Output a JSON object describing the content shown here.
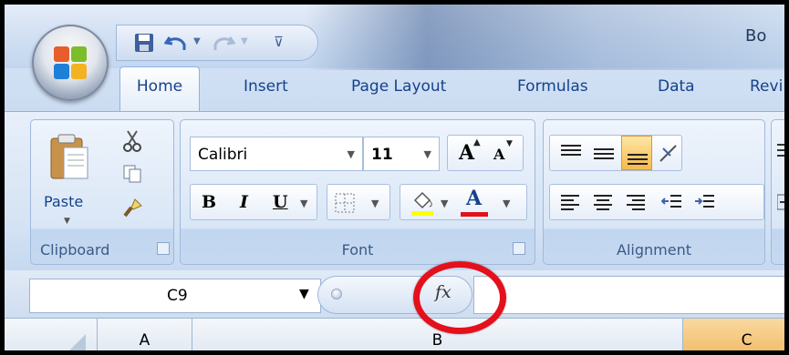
{
  "app": {
    "title_partial": "Bo"
  },
  "tabs": [
    {
      "label": "Home",
      "active": true
    },
    {
      "label": "Insert"
    },
    {
      "label": "Page Layout"
    },
    {
      "label": "Formulas"
    },
    {
      "label": "Data"
    },
    {
      "label": "Revi"
    }
  ],
  "ribbon": {
    "clipboard": {
      "label": "Clipboard",
      "paste_label": "Paste"
    },
    "font": {
      "label": "Font",
      "font_name": "Calibri",
      "font_size": "11",
      "grow_label": "A",
      "shrink_label": "A",
      "bold_label": "B",
      "italic_label": "I",
      "underline_label": "U",
      "font_color_label": "A",
      "highlight_color": "#ffff00",
      "font_color": "#e4101b"
    },
    "alignment": {
      "label": "Alignment"
    }
  },
  "formula_bar": {
    "name_box_value": "C9",
    "fx_label": "fx",
    "formula_value": ""
  },
  "columns": [
    {
      "label": "A",
      "selected": false
    },
    {
      "label": "B",
      "selected": false
    },
    {
      "label": "C",
      "selected": true
    }
  ],
  "annotation": {
    "highlight_color": "#e4101b",
    "target": "insert-function-button"
  }
}
